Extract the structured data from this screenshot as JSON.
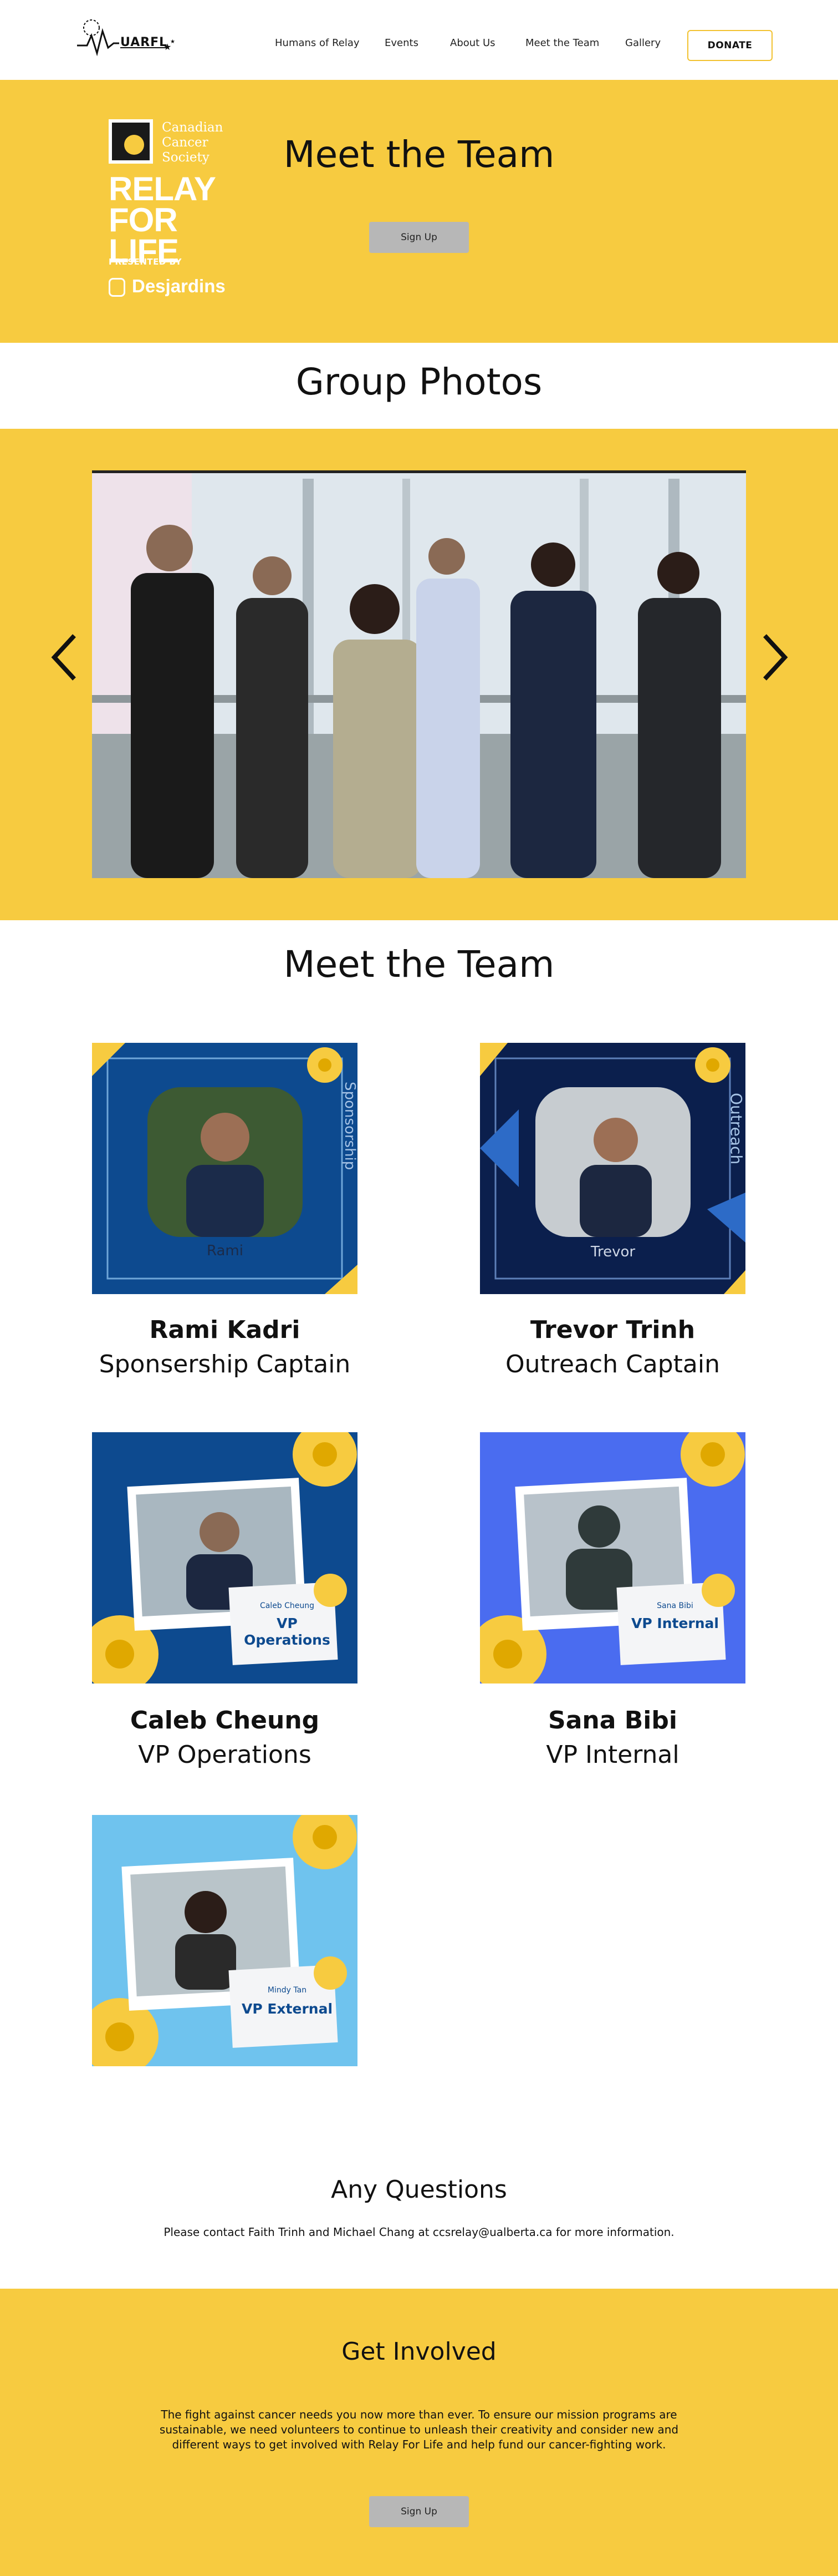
{
  "header": {
    "logo_text": "UARFL",
    "nav": [
      "Humans of Relay",
      "Events",
      "About Us",
      "Meet the Team",
      "Gallery"
    ],
    "donate_label": "DONATE"
  },
  "hero": {
    "ccs_text": "Canadian Cancer Society",
    "rfl_text": "RELAY FOR LIFE",
    "presented_by": "PRESENTED BY",
    "sponsor": "Desjardins",
    "title": "Meet the Team",
    "signup_label": "Sign Up"
  },
  "group_photos": {
    "title": "Group Photos"
  },
  "team": {
    "title": "Meet the Team",
    "members": [
      {
        "name": "Rami Kadri",
        "role": "Sponsership Captain",
        "card_name": "Rami",
        "card_side": "Sponsorship"
      },
      {
        "name": "Trevor Trinh",
        "role": "Outreach Captain",
        "card_name": "Trevor",
        "card_side": "Outreach"
      },
      {
        "name": "Caleb Cheung",
        "role": "VP Operations",
        "card_name": "Caleb Cheung",
        "card_title": "VP Operations"
      },
      {
        "name": "Sana Bibi",
        "role": "VP Internal",
        "card_name": "Sana Bibi",
        "card_title": "VP Internal"
      },
      {
        "card_name": "Mindy Tan",
        "card_title": "VP External"
      }
    ]
  },
  "questions": {
    "title": "Any Questions",
    "text": "Please contact Faith Trinh and Michael Chang at ccsrelay@ualberta.ca for more information."
  },
  "get_involved": {
    "title": "Get Involved",
    "text": "The fight against cancer needs you now more than ever. To ensure our mission programs are sustainable, we need volunteers to continue to unleash their creativity and consider new and different ways to get involved with Relay For Life and help fund our cancer-fighting work.",
    "signup_label": "Sign Up"
  },
  "colors": {
    "brand_yellow": "#f7cb40",
    "navy": "#0d4a8f",
    "dark_navy": "#0b1f4d",
    "royal_blue": "#4a6cf0",
    "sky_blue": "#6fc3ee",
    "button_grey": "#b7b7b7"
  }
}
